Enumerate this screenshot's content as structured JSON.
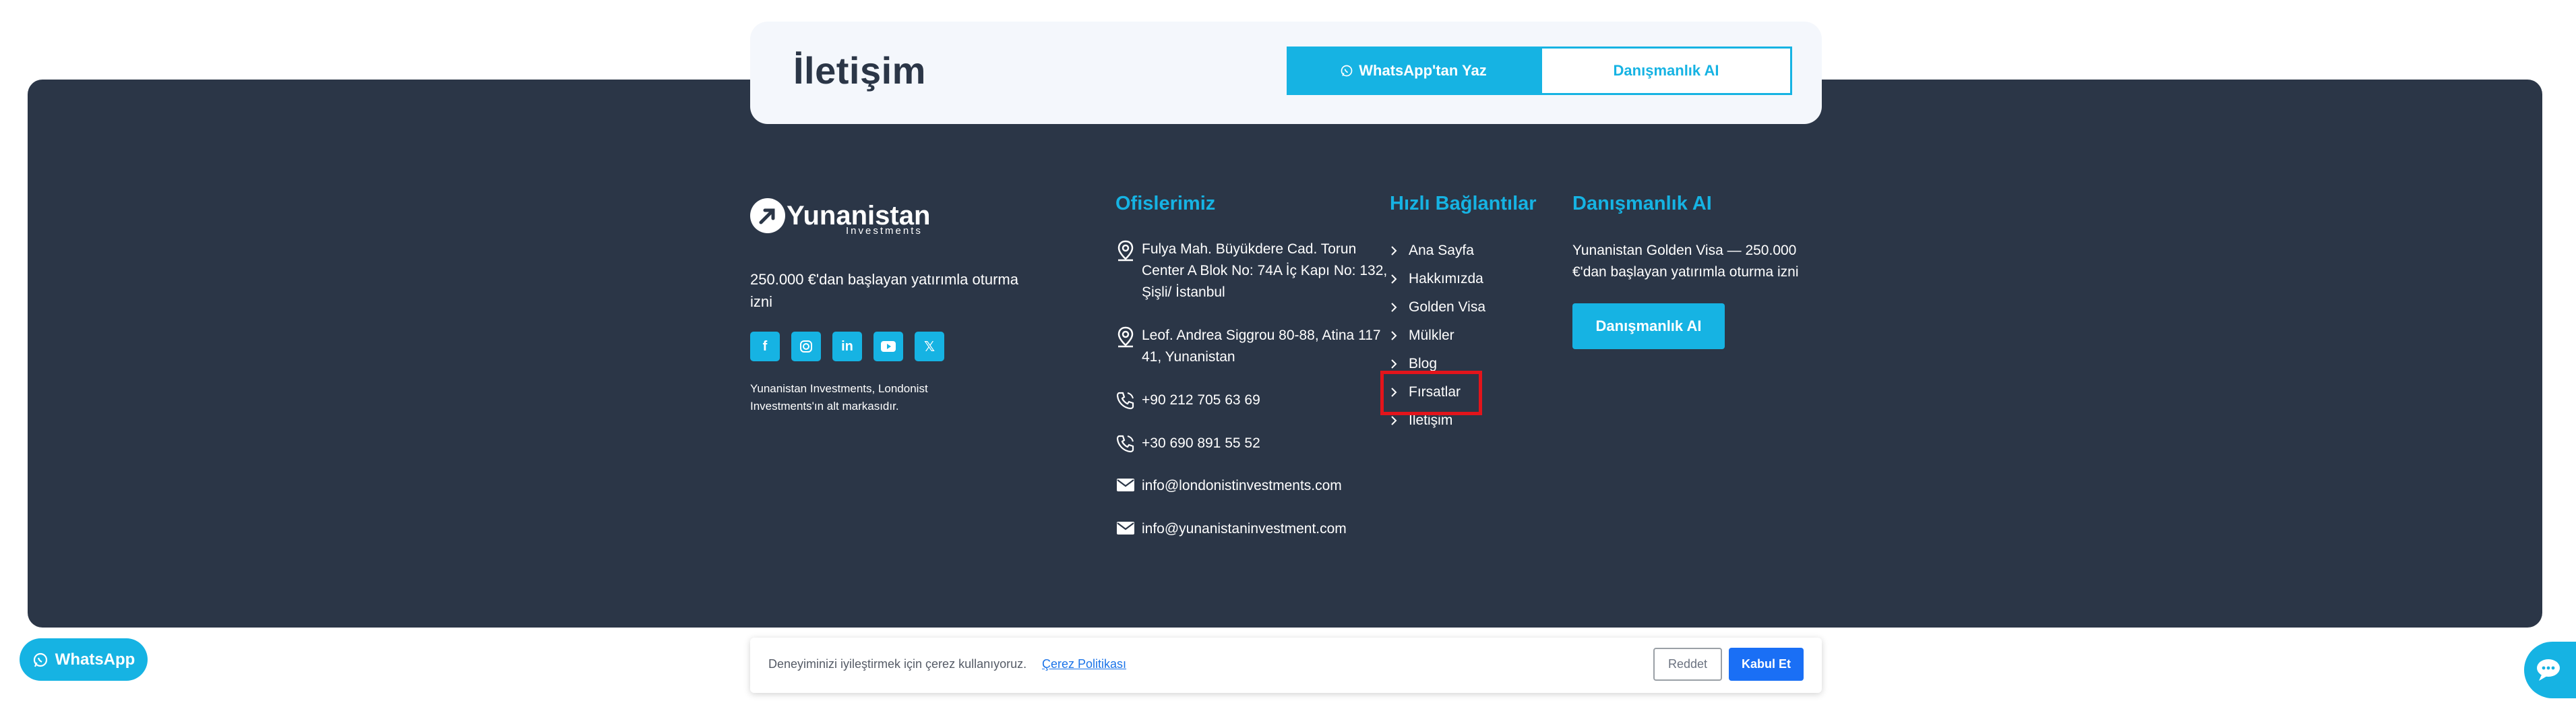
{
  "contact": {
    "title": "İletişim",
    "whatsapp_label": "WhatsApp'tan Yaz",
    "ai_label": "Danışmanlık AI"
  },
  "brand": {
    "logo_name": "Yunanistan",
    "logo_sub": "Investments",
    "description": "250.000 €'dan başlayan yatırımla oturma izni",
    "socials": [
      "facebook-icon",
      "instagram-icon",
      "linkedin-icon",
      "youtube-icon",
      "x-icon"
    ],
    "note": "Yunanistan Investments, Londonist Investments'ın alt markasıdır."
  },
  "offices": {
    "heading": "Ofislerimiz",
    "items": [
      {
        "icon": "map-pin-icon",
        "text": "Fulya Mah. Büyükdere Cad. Torun Center A Blok No: 74A İç Kapı No: 132, Şişli/ İstanbul"
      },
      {
        "icon": "map-pin-icon",
        "text": "Leof. Andrea Siggrou 80-88, Atina 117 41, Yunanistan"
      },
      {
        "icon": "phone-icon",
        "text": "+90 212 705 63 69"
      },
      {
        "icon": "phone-icon",
        "text": "+30 690 891 55 52"
      },
      {
        "icon": "mail-icon",
        "text": "info@londonistinvestments.com"
      },
      {
        "icon": "mail-icon",
        "text": "info@yunanistaninvestment.com"
      }
    ]
  },
  "quick_links": {
    "heading": "Hızlı Bağlantılar",
    "items": [
      "Ana Sayfa",
      "Hakkımızda",
      "Golden Visa",
      "Mülkler",
      "Blog",
      "Fırsatlar",
      "İletişim"
    ]
  },
  "ai": {
    "heading": "Danışmanlık AI",
    "description": "Yunanistan Golden Visa — 250.000 €'dan başlayan yatırımla oturma izni",
    "button": "Danışmanlık AI"
  },
  "cookie": {
    "text": "Deneyiminizi iyileştirmek için çerez kullanıyoruz.",
    "link": "Çerez Politikası",
    "reject": "Reddet",
    "accept": "Kabul Et"
  },
  "floating": {
    "whatsapp": "WhatsApp"
  },
  "colors": {
    "accent": "#16b3e3",
    "footer_bg": "#2b3647",
    "highlight": "#e3141b",
    "accept": "#1a6ff5"
  }
}
